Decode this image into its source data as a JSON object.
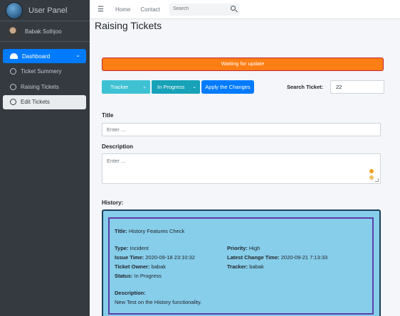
{
  "brand": {
    "title": "User Panel"
  },
  "user": {
    "name": "Babak Solhjoo"
  },
  "sidebar": {
    "items": [
      {
        "label": "Dashboard"
      },
      {
        "label": "Ticket Summery"
      },
      {
        "label": "Raising Tickets"
      },
      {
        "label": "Edit Tickets"
      }
    ]
  },
  "topbar": {
    "links": [
      "Home",
      "Contact"
    ],
    "search_placeholder": "Search"
  },
  "page": {
    "title": "Raising Tickets"
  },
  "alert": {
    "text": "Waiting for update"
  },
  "controls": {
    "type_select": "Tracker",
    "status_select": "In Progress",
    "apply_label": "Apply the Changes",
    "search_label": "Search Ticket:",
    "search_value": "22"
  },
  "form": {
    "title_label": "Title",
    "title_placeholder": "Enter ...",
    "description_label": "Description",
    "description_placeholder": "Enter ..."
  },
  "history": {
    "label": "History:",
    "title_key": "Title:",
    "title_value": "History Features Check",
    "type_key": "Type:",
    "type_value": "Incident",
    "priority_key": "Priority:",
    "priority_value": "High",
    "issue_time_key": "Issue Time:",
    "issue_time_value": "2020-09-18 23:10:32",
    "latest_change_key": "Latest Change Time:",
    "latest_change_value": "2020-09-21 7:13:33",
    "owner_key": "Ticket Owner:",
    "owner_value": "babak",
    "tracker_key": "Tracker:",
    "tracker_value": "babak",
    "status_key": "Status:",
    "status_value": "In Progress",
    "description_key": "Description:",
    "description_value": "New Test on the History functionality."
  },
  "colors": {
    "sidebar_bg": "#343a40",
    "active_nav": "#007bff",
    "alert_bg": "#fd7e14",
    "history_bg": "#87ceeb"
  }
}
